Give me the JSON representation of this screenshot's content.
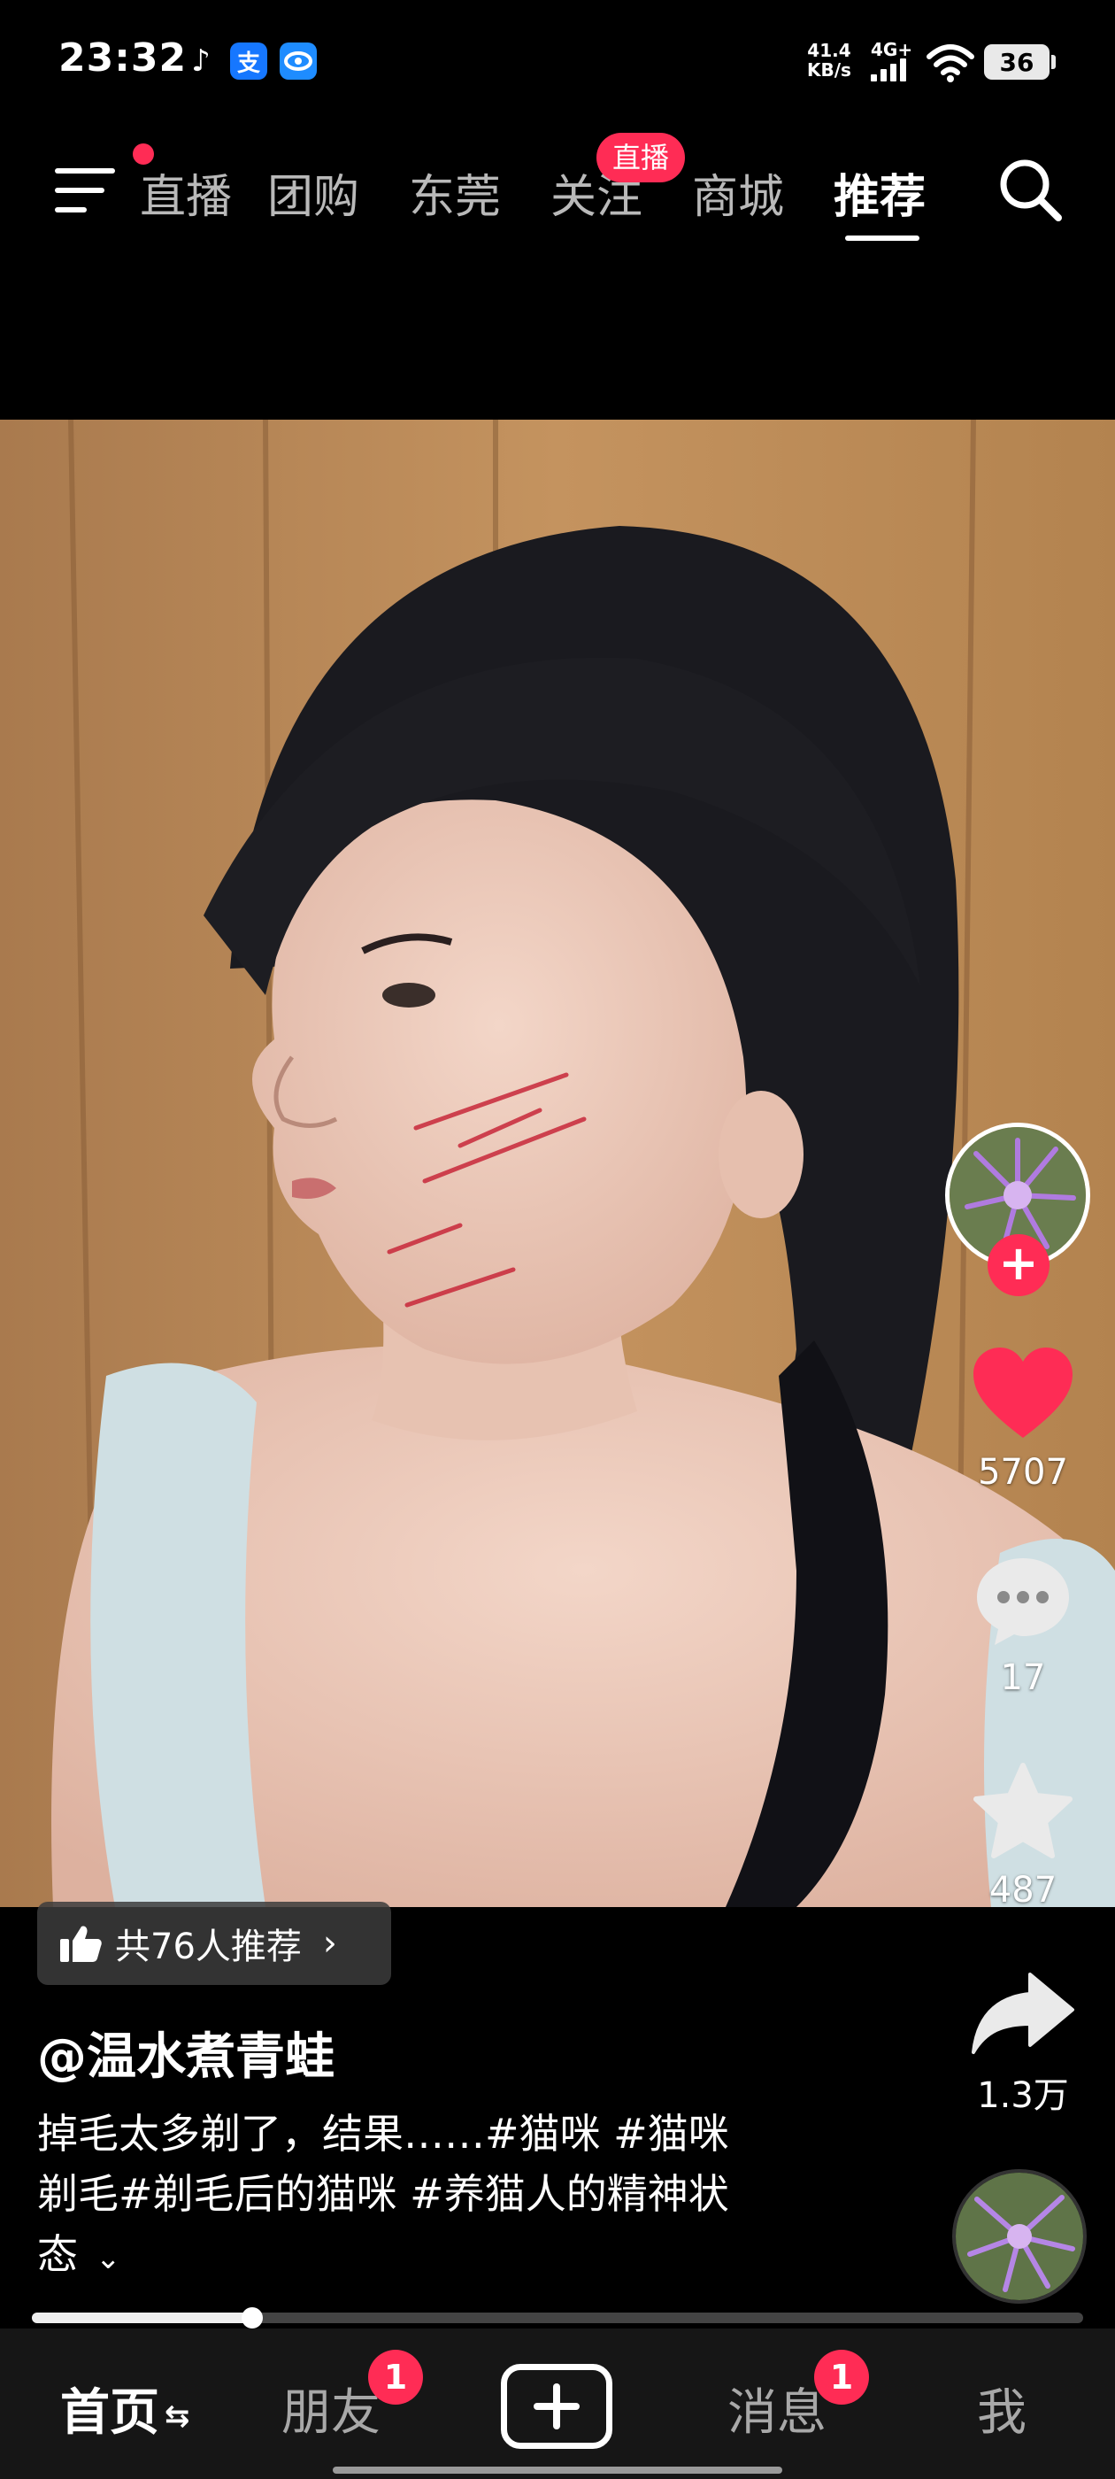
{
  "status_bar": {
    "time": "23:32",
    "net_speed_value": "41.4",
    "net_speed_unit": "KB/s",
    "network": "4G+",
    "battery": "36",
    "app_icons": [
      "tiktok-icon",
      "alipay-icon",
      "china-telecom-icon"
    ],
    "alipay_glyph": "支"
  },
  "top_nav": {
    "tabs": [
      "直播",
      "团购",
      "东莞",
      "关注",
      "商城",
      "推荐"
    ],
    "active_tab": "推荐",
    "follow_badge": "直播",
    "has_menu_notification": true
  },
  "video": {
    "background_color": "#b9865a"
  },
  "actions": {
    "likes": "5707",
    "comments": "17",
    "favorites": "487",
    "shares": "1.3万",
    "follow_symbol": "+"
  },
  "info": {
    "recommend_chip": "共76人推荐",
    "author": "@温水煮青蛙",
    "description_line1": "掉毛太多剃了，结果……#猫咪 #猫咪",
    "description_line2": "剃毛#剃毛后的猫咪 #养猫人的精神状",
    "description_line3": "态"
  },
  "progress": {
    "fraction": 0.21
  },
  "bottom_tabs": {
    "home": "首页",
    "friends": "朋友",
    "friends_badge": "1",
    "messages": "消息",
    "messages_badge": "1",
    "me": "我"
  },
  "colors": {
    "accent": "#ff2c55",
    "tab_bar_bg": "#161616",
    "like_heart": "#fe2c55"
  }
}
